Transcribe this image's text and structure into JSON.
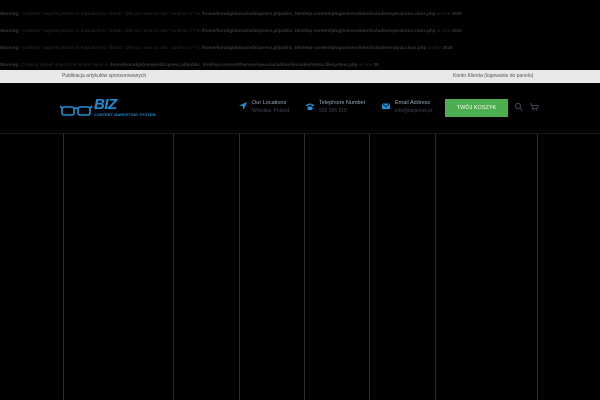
{
  "warnings": [
    {
      "label": "Warning:",
      "text": "\"continue\" targeting switch is equivalent to \"break\". Did you mean to use \"continue 2\"? in ",
      "path": "/home/koradg/domains/bizpress.pl/public_html/wp-content/plugins/revslider/includes/operations.class.php",
      "line_label": " on line ",
      "line": "2536"
    },
    {
      "label": "Warning:",
      "text": "\"continue\" targeting switch is equivalent to \"break\". Did you mean to use \"continue 2\"? in ",
      "path": "/home/koradg/domains/bizpress.pl/public_html/wp-content/plugins/revslider/includes/operations.class.php",
      "line_label": " on line ",
      "line": "2543"
    },
    {
      "label": "Warning:",
      "text": "\"continue\" targeting switch is equivalent to \"break\". Did you mean to use \"continue 2\"? in ",
      "path": "/home/koradg/domains/bizpress.pl/public_html/wp-content/plugins/revslider/includes/output.class.php",
      "line_label": " on line ",
      "line": "3025"
    },
    {
      "label": "Warning:",
      "text": "Creating default object from empty value in ",
      "path": "/home/koradg/domains/bizpress.pl/public_html/wp-content/themes/specular/admin/includes/redux.filesystem.php",
      "line_label": " on line ",
      "line": "29"
    }
  ],
  "topbar": {
    "left_link": "Publikacja artykułów sponsorowanych",
    "right_link": "Konto Klienta (logowanie do panelu)"
  },
  "logo": {
    "brand": "BIZ",
    "tagline": "CONTENT MARKETING SYSTEM"
  },
  "header_info": {
    "locations": {
      "title": "Our Locations",
      "value": "Wrocław, Poland"
    },
    "phone": {
      "title": "Telephone Number",
      "value": "502 306 515"
    },
    "email": {
      "title": "Email Address",
      "value": "info@bizpress.pl"
    }
  },
  "cart_button": {
    "label": "TWÓJ KOSZYK"
  },
  "icons": {
    "location": "location-arrow-icon",
    "phone": "phone-icon",
    "email": "envelope-icon",
    "search": "search-icon",
    "cart": "cart-icon"
  },
  "colors": {
    "accent_blue": "#1e8fd6",
    "button_green": "#4cae4f",
    "topbar_bg": "#e8e8e8",
    "background": "#000000"
  }
}
